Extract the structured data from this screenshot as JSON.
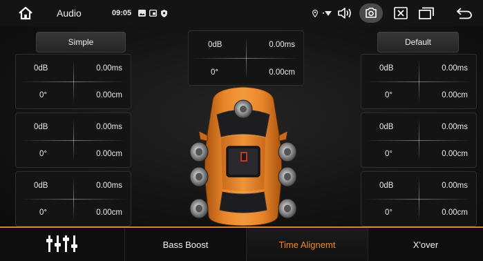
{
  "statusbar": {
    "title": "Audio",
    "time": "09:05",
    "icons": [
      "home-icon",
      "gallery-icon",
      "cast-icon",
      "shield-icon",
      "location-icon",
      "wifi-icon",
      "volume-icon",
      "screenshot-icon",
      "close-window-icon",
      "recent-apps-icon",
      "back-icon"
    ]
  },
  "presets": {
    "left_label": "Simple",
    "right_label": "Default"
  },
  "center_cell": {
    "gain": "0dB",
    "delay": "0.00ms",
    "phase": "0°",
    "distance": "0.00cm"
  },
  "left_cells": [
    {
      "gain": "0dB",
      "delay": "0.00ms",
      "phase": "0°",
      "distance": "0.00cm"
    },
    {
      "gain": "0dB",
      "delay": "0.00ms",
      "phase": "0°",
      "distance": "0.00cm"
    },
    {
      "gain": "0dB",
      "delay": "0.00ms",
      "phase": "0°",
      "distance": "0.00cm"
    }
  ],
  "right_cells": [
    {
      "gain": "0dB",
      "delay": "0.00ms",
      "phase": "0°",
      "distance": "0.00cm"
    },
    {
      "gain": "0dB",
      "delay": "0.00ms",
      "phase": "0°",
      "distance": "0.00cm"
    },
    {
      "gain": "0dB",
      "delay": "0.00ms",
      "phase": "0°",
      "distance": "0.00cm"
    }
  ],
  "tabs": [
    {
      "label": "",
      "icon": "equalizer-icon"
    },
    {
      "label": "Bass Boost"
    },
    {
      "label": "Time Alignemt",
      "active": true
    },
    {
      "label": "X'over"
    }
  ],
  "colors": {
    "accent": "#e8892a",
    "car_body": "#e07a22"
  }
}
